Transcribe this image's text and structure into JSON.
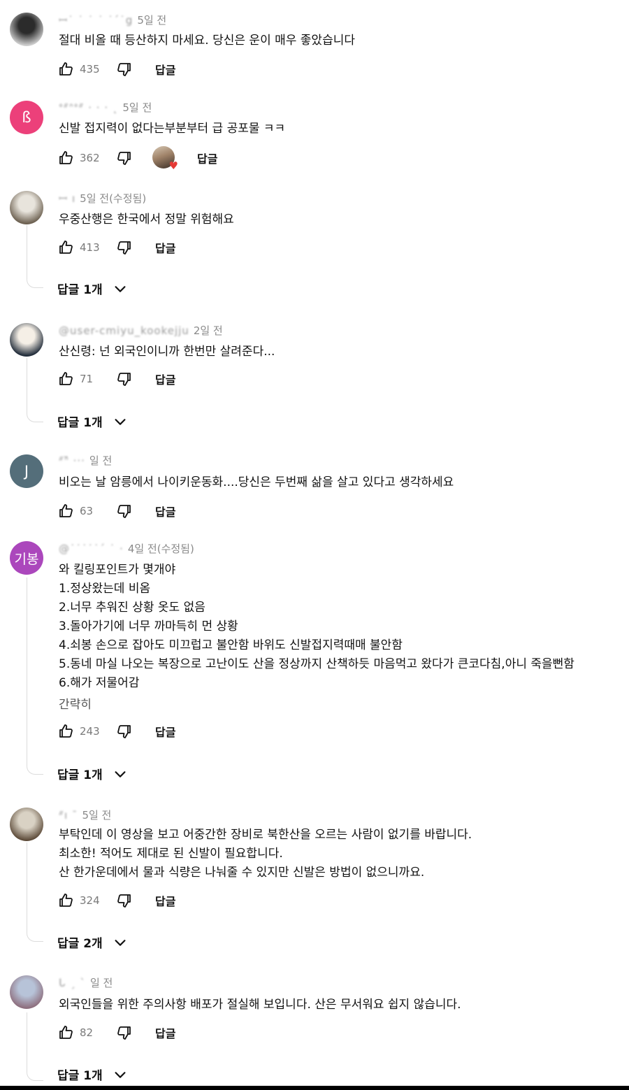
{
  "labels": {
    "reply": "답글"
  },
  "comments": [
    {
      "handle": "ꟷ˙ ˙ ˙ ˙ ˙ˊ˙g",
      "time": "5일 전",
      "text": [
        "절대 비올 때 등산하지 마세요. 당신은 운이 매우 좋았습니다"
      ],
      "likes": "435",
      "avatar": {
        "type": "photo",
        "colors": [
          "#2b2b2b",
          "#cfcfcf"
        ]
      }
    },
    {
      "handle": "ᐤᐥᐢᐤᐥ · · · ˛",
      "time": "5일 전",
      "text": [
        "신발 접지력이 없다는부분부터 급 공포물 ㅋㅋ"
      ],
      "likes": "362",
      "avatar": {
        "type": "letter",
        "letter": "ß",
        "color": "#ec407a"
      },
      "creator_heart": true
    },
    {
      "handle": "ꟷ                    ı",
      "time": "5일 전(수정됨)",
      "text": [
        "우중산행은 한국에서 정말 위험해요"
      ],
      "likes": "413",
      "avatar": {
        "type": "photo",
        "colors": [
          "#e8e4dc",
          "#6b5f4f"
        ]
      },
      "replies": "답글 1개"
    },
    {
      "handle": "@user-cmiyu_kookejju",
      "time": "2일 전",
      "text": [
        "산신령: 넌 외국인이니까 한번만 살려준다..."
      ],
      "likes": "71",
      "avatar": {
        "type": "photo",
        "colors": [
          "#f5efe6",
          "#1f2a38"
        ]
      },
      "replies": "답글 1개"
    },
    {
      "handle": "ᐥᐢ̈              ···",
      "time": "일 전",
      "text": [
        "비오는 날 암릉에서 나이키운동화....당신은 두번째 삶을 살고 있다고 생각하세요"
      ],
      "likes": "63",
      "avatar": {
        "type": "letter",
        "letter": "J",
        "color": "#546e7a"
      }
    },
    {
      "handle": "@˙˙˙˙˙ˊ ˙ ·",
      "time": "4일 전(수정됨)",
      "text": [
        "와 킬링포인트가 몇개야",
        "1.정상왔는데 비옴",
        "2.너무 추워진 상황 옷도 없음",
        "3.돌아가기에 너무 까마득히 먼 상황",
        "4.쇠봉 손으로 잡아도 미끄럽고 불안함 바위도 신발접지력때매 불안함",
        "5.동네 마실 나오는 복장으로 고난이도 산을 정상까지 산책하듯 마음먹고 왔다가 큰코다침,아니 죽을뻔함",
        "6.해가 저물어감"
      ],
      "extra": "간략히",
      "likes": "243",
      "avatar": {
        "type": "letter",
        "letter": "기봉",
        "color": "#ab47bc"
      },
      "replies": "답글 1개"
    },
    {
      "handle": "ᐥı ˉ",
      "time": "5일 전",
      "text": [
        "부탁인데 이 영상을 보고 어중간한 장비로 북한산을 오르는 사람이 없기를 바랍니다.",
        "최소한! 적어도 제대로 된 신발이 필요합니다.",
        "산 한가운데에서 물과 식량은 나눠줄 수 있지만 신발은 방법이 없으니까요."
      ],
      "likes": "324",
      "avatar": {
        "type": "photo",
        "colors": [
          "#d9d2c4",
          "#5c4a38"
        ]
      },
      "replies": "답글 2개"
    },
    {
      "handle": "ᒐ ˏ         ˋ",
      "time": "일 전",
      "text": [
        "외국인들을 위한 주의사항 배포가 절실해 보입니다. 산은 무서워요 쉽지 않습니다."
      ],
      "likes": "82",
      "avatar": {
        "type": "photo",
        "colors": [
          "#b7c3d8",
          "#8d6e7d"
        ]
      },
      "replies": "답글 1개"
    }
  ]
}
